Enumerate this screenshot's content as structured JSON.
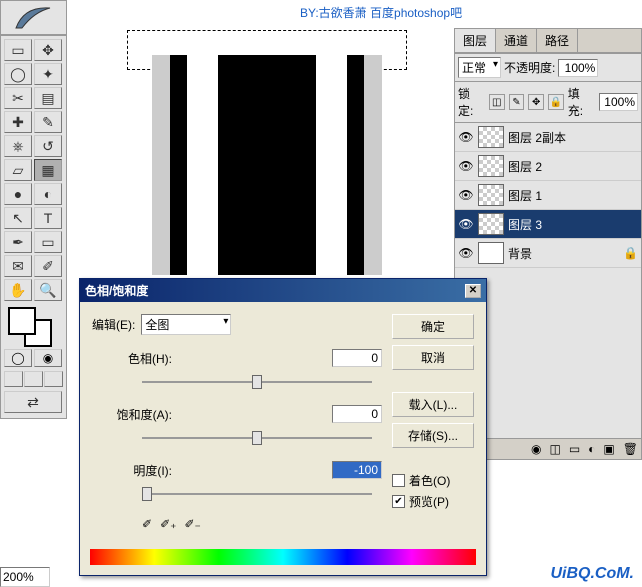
{
  "watermark": "BY:古欲香萧  百度photoshop吧",
  "uibq": "UiBQ.CoM.",
  "zoom": "200%",
  "panels": {
    "tabs": [
      "图层",
      "通道",
      "路径"
    ],
    "blend_mode": "正常",
    "opacity_label": "不透明度:",
    "opacity": "100%",
    "lock_label": "锁定:",
    "fill_label": "填充:",
    "fill": "100%",
    "layers": [
      {
        "name": "图层 2副本",
        "selected": false,
        "bg": false
      },
      {
        "name": "图层 2",
        "selected": false,
        "bg": false
      },
      {
        "name": "图层 1",
        "selected": false,
        "bg": false
      },
      {
        "name": "图层 3",
        "selected": true,
        "bg": false
      },
      {
        "name": "背景",
        "selected": false,
        "bg": true
      }
    ]
  },
  "dialog": {
    "title": "色相/饱和度",
    "edit_label": "编辑(E):",
    "edit_value": "全图",
    "hue_label": "色相(H):",
    "hue_value": "0",
    "sat_label": "饱和度(A):",
    "sat_value": "0",
    "light_label": "明度(I):",
    "light_value": "-100",
    "ok": "确定",
    "cancel": "取消",
    "load": "载入(L)...",
    "save": "存储(S)...",
    "colorize": "着色(O)",
    "preview": "预览(P)"
  }
}
